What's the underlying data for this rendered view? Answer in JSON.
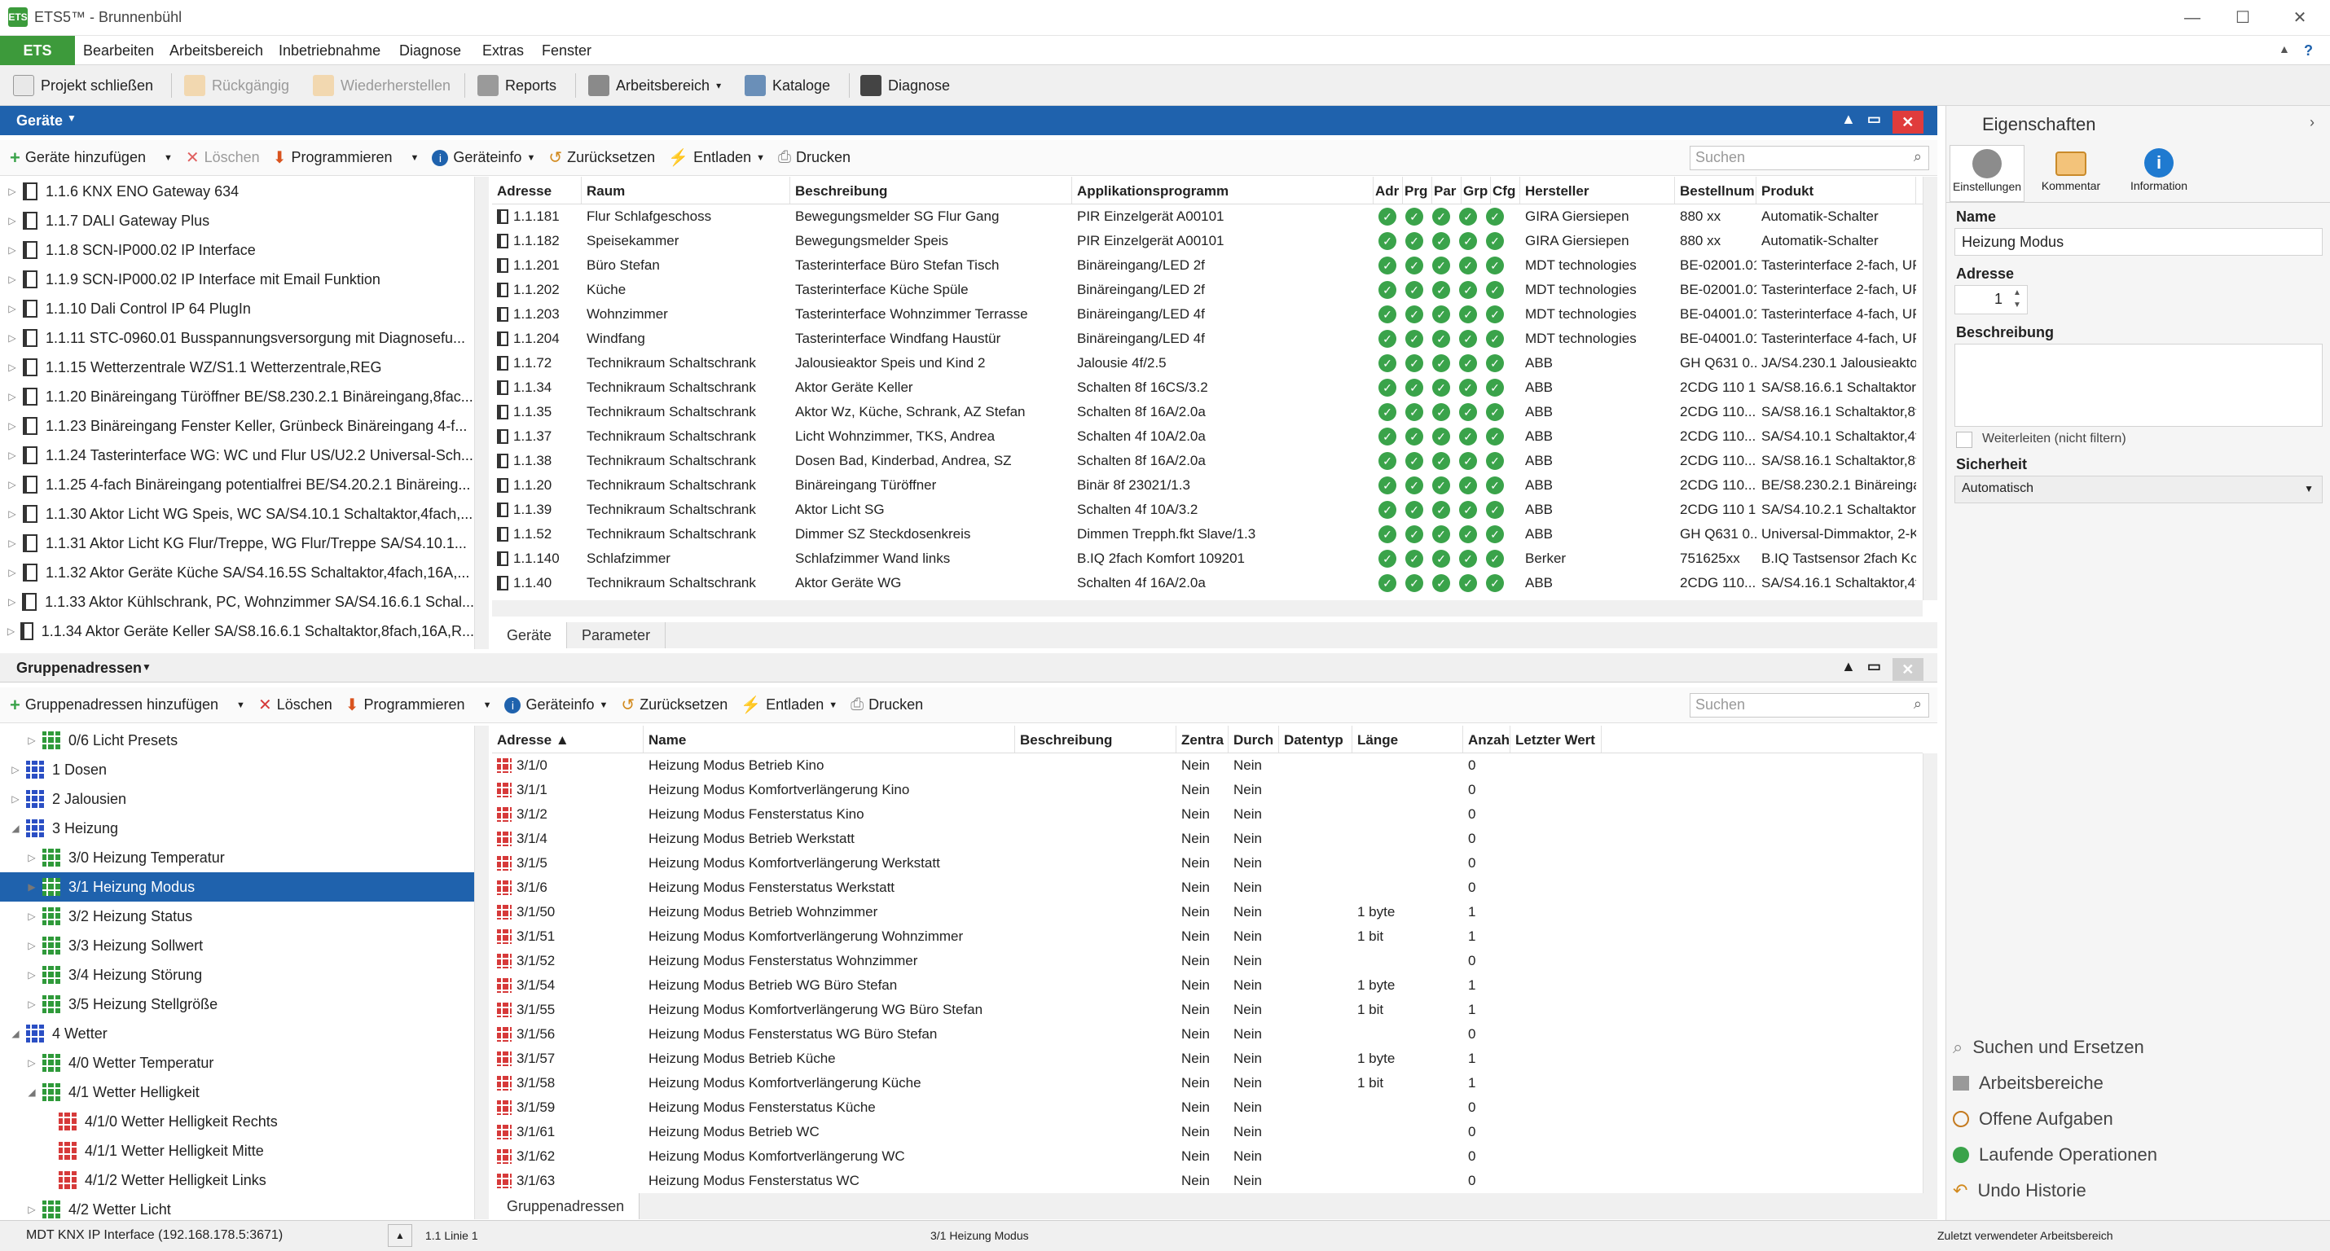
{
  "window": {
    "app_icon": "ets-app-icon",
    "title": "ETS5™ - Brunnenbühl",
    "minimize": "—",
    "maximize": "☐",
    "close": "✕"
  },
  "menu": {
    "ets": "ETS",
    "items": [
      "Bearbeiten",
      "Arbeitsbereich",
      "Inbetriebnahme",
      "Diagnose",
      "Extras",
      "Fenster"
    ],
    "collapse": "▲",
    "help": "?"
  },
  "toolbar": {
    "close_project": "Projekt schließen",
    "undo": "Rückgängig",
    "redo": "Wiederherstellen",
    "reports": "Reports",
    "workspace": "Arbeitsbereich",
    "catalogs": "Kataloge",
    "diagnose": "Diagnose"
  },
  "devices_panel": {
    "title": "Geräte",
    "toolbar": {
      "add": "Geräte hinzufügen",
      "delete": "Löschen",
      "program": "Programmieren",
      "info": "Geräteinfo",
      "reset": "Zurücksetzen",
      "unload": "Entladen",
      "print": "Drucken",
      "search_placeholder": "Suchen"
    },
    "tree": [
      "1.1.6 KNX ENO Gateway 634",
      "1.1.7 DALI Gateway Plus",
      "1.1.8 SCN-IP000.02 IP Interface",
      "1.1.9 SCN-IP000.02 IP Interface mit Email Funktion",
      "1.1.10 Dali Control IP 64 PlugIn",
      "1.1.11 STC-0960.01 Busspannungsversorgung mit Diagnosefu...",
      "1.1.15 Wetterzentrale WZ/S1.1 Wetterzentrale,REG",
      "1.1.20 Binäreingang Türöffner BE/S8.230.2.1 Binäreingang,8fac...",
      "1.1.23 Binäreingang Fenster Keller, Grünbeck Binäreingang 4-f...",
      "1.1.24 Tasterinterface WG: WC und Flur US/U2.2 Universal-Sch...",
      "1.1.25 4-fach Binäreingang potentialfrei BE/S4.20.2.1 Binäreing...",
      "1.1.30 Aktor Licht WG Speis, WC SA/S4.10.1 Schaltaktor,4fach,...",
      "1.1.31 Aktor Licht KG Flur/Treppe, WG Flur/Treppe SA/S4.10.1...",
      "1.1.32 Aktor Geräte Küche SA/S4.16.5S Schaltaktor,4fach,16A,...",
      "1.1.33 Aktor Kühlschrank, PC, Wohnzimmer SA/S4.16.6.1 Schal...",
      "1.1.34 Aktor Geräte Keller SA/S8.16.6.1 Schaltaktor,8fach,16A,R..."
    ],
    "columns": [
      "Adresse",
      "Raum",
      "Beschreibung",
      "Applikationsprogramm",
      "Adr",
      "Prg",
      "Par",
      "Grp",
      "Cfg",
      "Hersteller",
      "Bestellnum",
      "Produkt"
    ],
    "rows": [
      [
        "1.1.181",
        "Flur Schlafgeschoss",
        "Bewegungsmelder SG Flur Gang",
        "PIR Einzelgerät A00101",
        "GIRA Giersiepen",
        "880 xx",
        "Automatik-Schalter"
      ],
      [
        "1.1.182",
        "Speisekammer",
        "Bewegungsmelder Speis",
        "PIR Einzelgerät A00101",
        "GIRA Giersiepen",
        "880 xx",
        "Automatik-Schalter"
      ],
      [
        "1.1.201",
        "Büro Stefan",
        "Tasterinterface Büro Stefan Tisch",
        "Binäreingang/LED 2f",
        "MDT technologies",
        "BE-02001.01",
        "Tasterinterface 2-fach, UP"
      ],
      [
        "1.1.202",
        "Küche",
        "Tasterinterface Küche Spüle",
        "Binäreingang/LED 2f",
        "MDT technologies",
        "BE-02001.01",
        "Tasterinterface 2-fach, UP"
      ],
      [
        "1.1.203",
        "Wohnzimmer",
        "Tasterinterface Wohnzimmer Terrasse",
        "Binäreingang/LED 4f",
        "MDT technologies",
        "BE-04001.01",
        "Tasterinterface 4-fach, UP"
      ],
      [
        "1.1.204",
        "Windfang",
        "Tasterinterface Windfang Haustür",
        "Binäreingang/LED 4f",
        "MDT technologies",
        "BE-04001.01",
        "Tasterinterface 4-fach, UP"
      ],
      [
        "1.1.72",
        "Technikraum Schaltschrank",
        "Jalousieaktor Speis und Kind 2",
        "Jalousie 4f/2.5",
        "ABB",
        "GH Q631 0...",
        "JA/S4.230.1 Jalousieaktor,4f"
      ],
      [
        "1.1.34",
        "Technikraum Schaltschrank",
        "Aktor Geräte Keller",
        "Schalten 8f 16CS/3.2",
        "ABB",
        "2CDG 110 1...",
        "SA/S8.16.6.1 Schaltaktor,8fa"
      ],
      [
        "1.1.35",
        "Technikraum Schaltschrank",
        "Aktor Wz, Küche, Schrank, AZ Stefan",
        "Schalten 8f 16A/2.0a",
        "ABB",
        "2CDG 110...",
        "SA/S8.16.1 Schaltaktor,8fach"
      ],
      [
        "1.1.37",
        "Technikraum Schaltschrank",
        "Licht Wohnzimmer, TKS, Andrea",
        "Schalten 4f 10A/2.0a",
        "ABB",
        "2CDG 110...",
        "SA/S4.10.1 Schaltaktor,4fach"
      ],
      [
        "1.1.38",
        "Technikraum Schaltschrank",
        "Dosen Bad, Kinderbad, Andrea, SZ",
        "Schalten 8f 16A/2.0a",
        "ABB",
        "2CDG 110...",
        "SA/S8.16.1 Schaltaktor,8fach"
      ],
      [
        "1.1.20",
        "Technikraum Schaltschrank",
        "Binäreingang Türöffner",
        "Binär 8f 23021/1.3",
        "ABB",
        "2CDG 110...",
        "BE/S8.230.2.1 Binäreingang"
      ],
      [
        "1.1.39",
        "Technikraum Schaltschrank",
        "Aktor Licht SG",
        "Schalten 4f 10A/3.2",
        "ABB",
        "2CDG 110 1...",
        "SA/S4.10.2.1 Schaltaktor,4fa"
      ],
      [
        "1.1.52",
        "Technikraum Schaltschrank",
        "Dimmer SZ Steckdosenkreis",
        "Dimmen Trepph.fkt Slave/1.3",
        "ABB",
        "GH Q631 0...",
        "Universal-Dimmaktor, 2-Ka"
      ],
      [
        "1.1.140",
        "Schlafzimmer",
        "Schlafzimmer Wand links",
        "B.IQ 2fach Komfort 109201",
        "Berker",
        "751625xx",
        "B.IQ Tastsensor 2fach Komf"
      ],
      [
        "1.1.40",
        "Technikraum Schaltschrank",
        "Aktor Geräte WG",
        "Schalten 4f 16A/2.0a",
        "ABB",
        "2CDG 110...",
        "SA/S4.16.1 Schaltaktor,4fach"
      ]
    ],
    "tabs": [
      "Geräte",
      "Parameter"
    ]
  },
  "ga_panel": {
    "title": "Gruppenadressen",
    "toolbar": {
      "add": "Gruppenadressen hinzufügen",
      "delete": "Löschen",
      "program": "Programmieren",
      "info": "Geräteinfo",
      "reset": "Zurücksetzen",
      "unload": "Entladen",
      "print": "Drucken",
      "search_placeholder": "Suchen"
    },
    "tree": [
      {
        "label": "0/6 Licht Presets",
        "level": 1,
        "color": "green",
        "exp": "▷"
      },
      {
        "label": "1 Dosen",
        "level": 0,
        "color": "blue",
        "exp": "▷"
      },
      {
        "label": "2 Jalousien",
        "level": 0,
        "color": "blue",
        "exp": "▷"
      },
      {
        "label": "3 Heizung",
        "level": 0,
        "color": "blue",
        "exp": "◢"
      },
      {
        "label": "3/0 Heizung Temperatur",
        "level": 1,
        "color": "green",
        "exp": "▷"
      },
      {
        "label": "3/1 Heizung Modus",
        "level": 1,
        "color": "green",
        "exp": "▶",
        "selected": true
      },
      {
        "label": "3/2 Heizung Status",
        "level": 1,
        "color": "green",
        "exp": "▷"
      },
      {
        "label": "3/3 Heizung Sollwert",
        "level": 1,
        "color": "green",
        "exp": "▷"
      },
      {
        "label": "3/4 Heizung Störung",
        "level": 1,
        "color": "green",
        "exp": "▷"
      },
      {
        "label": "3/5 Heizung Stellgröße",
        "level": 1,
        "color": "green",
        "exp": "▷"
      },
      {
        "label": "4 Wetter",
        "level": 0,
        "color": "blue",
        "exp": "◢"
      },
      {
        "label": "4/0 Wetter Temperatur",
        "level": 1,
        "color": "green",
        "exp": "▷"
      },
      {
        "label": "4/1 Wetter Helligkeit",
        "level": 1,
        "color": "green",
        "exp": "◢"
      },
      {
        "label": "4/1/0 Wetter Helligkeit Rechts",
        "level": 2,
        "color": "red",
        "exp": ""
      },
      {
        "label": "4/1/1 Wetter Helligkeit Mitte",
        "level": 2,
        "color": "red",
        "exp": ""
      },
      {
        "label": "4/1/2 Wetter Helligkeit Links",
        "level": 2,
        "color": "red",
        "exp": ""
      },
      {
        "label": "4/2 Wetter Licht",
        "level": 1,
        "color": "green",
        "exp": "▷"
      }
    ],
    "columns": [
      "Adresse ▲",
      "Name",
      "Beschreibung",
      "Zentra",
      "Durch",
      "Datentyp",
      "Länge",
      "Anzah",
      "Letzter Wert"
    ],
    "rows": [
      [
        "3/1/0",
        "Heizung Modus Betrieb Kino",
        "",
        "Nein",
        "Nein",
        "",
        "",
        "0"
      ],
      [
        "3/1/1",
        "Heizung Modus Komfortverlängerung Kino",
        "",
        "Nein",
        "Nein",
        "",
        "",
        "0"
      ],
      [
        "3/1/2",
        "Heizung Modus Fensterstatus Kino",
        "",
        "Nein",
        "Nein",
        "",
        "",
        "0"
      ],
      [
        "3/1/4",
        "Heizung Modus Betrieb Werkstatt",
        "",
        "Nein",
        "Nein",
        "",
        "",
        "0"
      ],
      [
        "3/1/5",
        "Heizung Modus Komfortverlängerung Werkstatt",
        "",
        "Nein",
        "Nein",
        "",
        "",
        "0"
      ],
      [
        "3/1/6",
        "Heizung Modus Fensterstatus Werkstatt",
        "",
        "Nein",
        "Nein",
        "",
        "",
        "0"
      ],
      [
        "3/1/50",
        "Heizung Modus Betrieb Wohnzimmer",
        "",
        "Nein",
        "Nein",
        "",
        "1 byte",
        "1"
      ],
      [
        "3/1/51",
        "Heizung Modus Komfortverlängerung Wohnzimmer",
        "",
        "Nein",
        "Nein",
        "",
        "1 bit",
        "1"
      ],
      [
        "3/1/52",
        "Heizung Modus Fensterstatus Wohnzimmer",
        "",
        "Nein",
        "Nein",
        "",
        "",
        "0"
      ],
      [
        "3/1/54",
        "Heizung Modus Betrieb WG Büro Stefan",
        "",
        "Nein",
        "Nein",
        "",
        "1 byte",
        "1"
      ],
      [
        "3/1/55",
        "Heizung Modus Komfortverlängerung WG Büro Stefan",
        "",
        "Nein",
        "Nein",
        "",
        "1 bit",
        "1"
      ],
      [
        "3/1/56",
        "Heizung Modus Fensterstatus WG Büro Stefan",
        "",
        "Nein",
        "Nein",
        "",
        "",
        "0"
      ],
      [
        "3/1/57",
        "Heizung Modus Betrieb Küche",
        "",
        "Nein",
        "Nein",
        "",
        "1 byte",
        "1"
      ],
      [
        "3/1/58",
        "Heizung Modus Komfortverlängerung Küche",
        "",
        "Nein",
        "Nein",
        "",
        "1 bit",
        "1"
      ],
      [
        "3/1/59",
        "Heizung Modus Fensterstatus Küche",
        "",
        "Nein",
        "Nein",
        "",
        "",
        "0"
      ],
      [
        "3/1/61",
        "Heizung Modus Betrieb WC",
        "",
        "Nein",
        "Nein",
        "",
        "",
        "0"
      ],
      [
        "3/1/62",
        "Heizung Modus Komfortverlängerung WC",
        "",
        "Nein",
        "Nein",
        "",
        "",
        "0"
      ],
      [
        "3/1/63",
        "Heizung Modus Fensterstatus WC",
        "",
        "Nein",
        "Nein",
        "",
        "",
        "0"
      ]
    ],
    "tabs": [
      "Gruppenadressen"
    ]
  },
  "properties": {
    "title": "Eigenschaften",
    "tabs": [
      "Einstellungen",
      "Kommentar",
      "Information"
    ],
    "name_label": "Name",
    "name_value": "Heizung Modus",
    "address_label": "Adresse",
    "address_value": "1",
    "description_label": "Beschreibung",
    "description_value": "",
    "forward_label": "Weiterleiten (nicht filtern)",
    "security_label": "Sicherheit",
    "security_value": "Automatisch",
    "bottom_links": [
      "Suchen und Ersetzen",
      "Arbeitsbereiche",
      "Offene Aufgaben",
      "Laufende Operationen",
      "Undo Historie"
    ]
  },
  "status": {
    "interface": "MDT KNX IP Interface (192.168.178.5:3671)",
    "line": "1.1 Linie 1",
    "selection": "3/1 Heizung Modus",
    "workspace": "Zuletzt verwendeter Arbeitsbereich"
  },
  "colors": {
    "accent": "#1f62ad",
    "ets_green": "#3d9a3b",
    "close_red": "#e03c3c",
    "check_green": "#3aa34a"
  }
}
